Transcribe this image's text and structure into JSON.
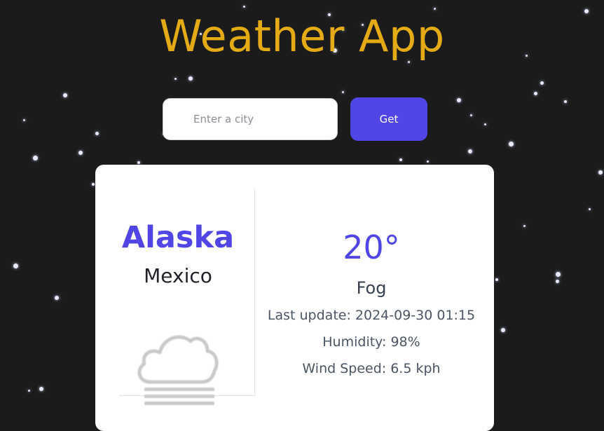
{
  "app": {
    "title": "Weather App"
  },
  "search": {
    "placeholder": "Enter a city",
    "value": "",
    "button_label": "Get"
  },
  "weather": {
    "city": "Alaska",
    "country": "Mexico",
    "temperature": "20°",
    "condition": "Fog",
    "condition_icon": "fog-cloud-icon",
    "last_update": "Last update: 2024-09-30 01:15",
    "humidity": "Humidity: 98%",
    "wind_speed": "Wind Speed: 6.5 kph"
  },
  "colors": {
    "background": "#1b1b1b",
    "title": "#e5ab14",
    "accent": "#4f46e5",
    "card": "#ffffff",
    "star": "#e8eaff"
  }
}
